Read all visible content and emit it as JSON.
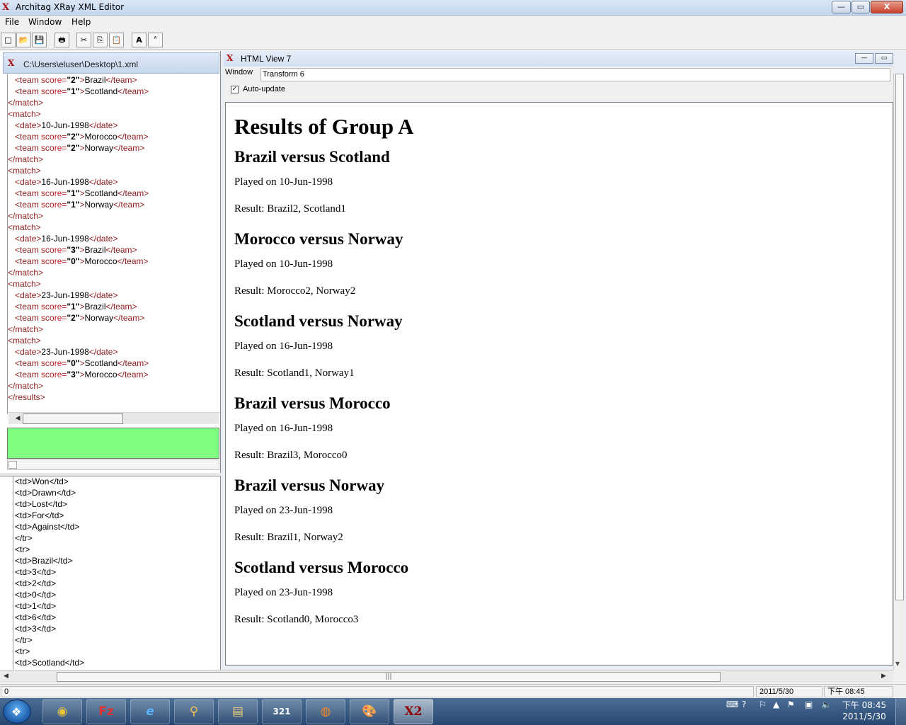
{
  "window": {
    "title": "Architag XRay XML Editor",
    "app_icon": "X2-logo-icon",
    "minimize": "—",
    "maximize": "▭",
    "close": "X"
  },
  "menu": [
    "File",
    "Window",
    "Help"
  ],
  "toolbar": {
    "icons": [
      "new-file-icon",
      "open-folder-icon",
      "save-icon",
      "print-icon",
      "cut-icon",
      "copy-icon",
      "paste-icon",
      "font-larger-icon",
      "font-smaller-icon"
    ],
    "glyphs": [
      "□",
      "📂",
      "💾",
      "🖶",
      "✂",
      "⎘",
      "📋",
      "A",
      "ᴬ"
    ]
  },
  "xml_editor": {
    "path": "C:\\Users\\eluser\\Desktop\\1.xml",
    "lines": [
      {
        "indent": "   ",
        "open": "<team ",
        "attr": "score=",
        "val": "\"2\"",
        "close_open": ">",
        "text": "Brazil",
        "end": "</team>"
      },
      {
        "indent": "   ",
        "open": "<team ",
        "attr": "score=",
        "val": "\"1\"",
        "close_open": ">",
        "text": "Scotland",
        "end": "</team>"
      },
      {
        "indent": "",
        "open": "</match>",
        "attr": "",
        "val": "",
        "close_open": "",
        "text": "",
        "end": ""
      },
      {
        "indent": "",
        "open": "<match>",
        "attr": "",
        "val": "",
        "close_open": "",
        "text": "",
        "end": ""
      },
      {
        "indent": "   ",
        "open": "<date>",
        "attr": "",
        "val": "",
        "close_open": "",
        "text": "10-Jun-1998",
        "end": "</date>"
      },
      {
        "indent": "   ",
        "open": "<team ",
        "attr": "score=",
        "val": "\"2\"",
        "close_open": ">",
        "text": "Morocco",
        "end": "</team>"
      },
      {
        "indent": "   ",
        "open": "<team ",
        "attr": "score=",
        "val": "\"2\"",
        "close_open": ">",
        "text": "Norway",
        "end": "</team>"
      },
      {
        "indent": "",
        "open": "</match>",
        "attr": "",
        "val": "",
        "close_open": "",
        "text": "",
        "end": ""
      },
      {
        "indent": "",
        "open": "<match>",
        "attr": "",
        "val": "",
        "close_open": "",
        "text": "",
        "end": ""
      },
      {
        "indent": "   ",
        "open": "<date>",
        "attr": "",
        "val": "",
        "close_open": "",
        "text": "16-Jun-1998",
        "end": "</date>"
      },
      {
        "indent": "   ",
        "open": "<team ",
        "attr": "score=",
        "val": "\"1\"",
        "close_open": ">",
        "text": "Scotland",
        "end": "</team>"
      },
      {
        "indent": "   ",
        "open": "<team ",
        "attr": "score=",
        "val": "\"1\"",
        "close_open": ">",
        "text": "Norway",
        "end": "</team>"
      },
      {
        "indent": "",
        "open": "</match>",
        "attr": "",
        "val": "",
        "close_open": "",
        "text": "",
        "end": ""
      },
      {
        "indent": "",
        "open": "<match>",
        "attr": "",
        "val": "",
        "close_open": "",
        "text": "",
        "end": ""
      },
      {
        "indent": "   ",
        "open": "<date>",
        "attr": "",
        "val": "",
        "close_open": "",
        "text": "16-Jun-1998",
        "end": "</date>"
      },
      {
        "indent": "   ",
        "open": "<team ",
        "attr": "score=",
        "val": "\"3\"",
        "close_open": ">",
        "text": "Brazil",
        "end": "</team>"
      },
      {
        "indent": "   ",
        "open": "<team ",
        "attr": "score=",
        "val": "\"0\"",
        "close_open": ">",
        "text": "Morocco",
        "end": "</team>"
      },
      {
        "indent": "",
        "open": "</match>",
        "attr": "",
        "val": "",
        "close_open": "",
        "text": "",
        "end": ""
      },
      {
        "indent": "",
        "open": "<match>",
        "attr": "",
        "val": "",
        "close_open": "",
        "text": "",
        "end": ""
      },
      {
        "indent": "   ",
        "open": "<date>",
        "attr": "",
        "val": "",
        "close_open": "",
        "text": "23-Jun-1998",
        "end": "</date>"
      },
      {
        "indent": "   ",
        "open": "<team ",
        "attr": "score=",
        "val": "\"1\"",
        "close_open": ">",
        "text": "Brazil",
        "end": "</team>"
      },
      {
        "indent": "   ",
        "open": "<team ",
        "attr": "score=",
        "val": "\"2\"",
        "close_open": ">",
        "text": "Norway",
        "end": "</team>"
      },
      {
        "indent": "",
        "open": "</match>",
        "attr": "",
        "val": "",
        "close_open": "",
        "text": "",
        "end": ""
      },
      {
        "indent": "",
        "open": "<match>",
        "attr": "",
        "val": "",
        "close_open": "",
        "text": "",
        "end": ""
      },
      {
        "indent": "   ",
        "open": "<date>",
        "attr": "",
        "val": "",
        "close_open": "",
        "text": "23-Jun-1998",
        "end": "</date>"
      },
      {
        "indent": "   ",
        "open": "<team ",
        "attr": "score=",
        "val": "\"0\"",
        "close_open": ">",
        "text": "Scotland",
        "end": "</team>"
      },
      {
        "indent": "   ",
        "open": "<team ",
        "attr": "score=",
        "val": "\"3\"",
        "close_open": ">",
        "text": "Morocco",
        "end": "</team>"
      },
      {
        "indent": "",
        "open": "</match>",
        "attr": "",
        "val": "",
        "close_open": "",
        "text": "",
        "end": ""
      },
      {
        "indent": "",
        "open": "</results>",
        "attr": "",
        "val": "",
        "close_open": "",
        "text": "",
        "end": ""
      }
    ],
    "status_color": "#7fff7f"
  },
  "xslt_editor": {
    "lines": [
      "<td>Won</td>",
      "<td>Drawn</td>",
      "<td>Lost</td>",
      "<td>For</td>",
      "<td>Against</td>",
      "</tr>",
      "<tr>",
      "<td>Brazil</td>",
      "<td>3</td>",
      "<td>2</td>",
      "<td>0</td>",
      "<td>1</td>",
      "<td>6</td>",
      "<td>3</td>",
      "</tr>",
      "<tr>",
      "<td>Scotland</td>"
    ]
  },
  "html_view": {
    "title": "HTML View 7",
    "window_label": "Window",
    "window_value": "Transform 6",
    "auto_update_label": "Auto-update",
    "auto_update_checked": "✓",
    "heading": "Results of Group A",
    "matches": [
      {
        "title": "Brazil versus Scotland",
        "played": "Played on 10-Jun-1998",
        "result": "Result: Brazil2, Scotland1"
      },
      {
        "title": "Morocco versus Norway",
        "played": "Played on 10-Jun-1998",
        "result": "Result: Morocco2, Norway2"
      },
      {
        "title": "Scotland versus Norway",
        "played": "Played on 16-Jun-1998",
        "result": "Result: Scotland1, Norway1"
      },
      {
        "title": "Brazil versus Morocco",
        "played": "Played on 16-Jun-1998",
        "result": "Result: Brazil3, Morocco0"
      },
      {
        "title": "Brazil versus Norway",
        "played": "Played on 23-Jun-1998",
        "result": "Result: Brazil1, Norway2"
      },
      {
        "title": "Scotland versus Morocco",
        "played": "Played on 23-Jun-1998",
        "result": "Result: Scotland0, Morocco3"
      }
    ]
  },
  "status": {
    "position": "0",
    "date": "2011/5/30",
    "time": "下午 08:45"
  },
  "taskbar": {
    "items": [
      "chrome-icon",
      "filezilla-icon",
      "internet-explorer-icon",
      "search-tool-icon",
      "file-explorer-icon",
      "media-player-icon",
      "firefox-icon",
      "paint-icon",
      "xray-icon"
    ],
    "glyphs": [
      "◉",
      "Fz",
      "e",
      "⚲",
      "▤",
      "321",
      "◍",
      "🎨",
      "X2"
    ],
    "clock_time": "下午 08:45",
    "clock_date": "2011/5/30"
  }
}
